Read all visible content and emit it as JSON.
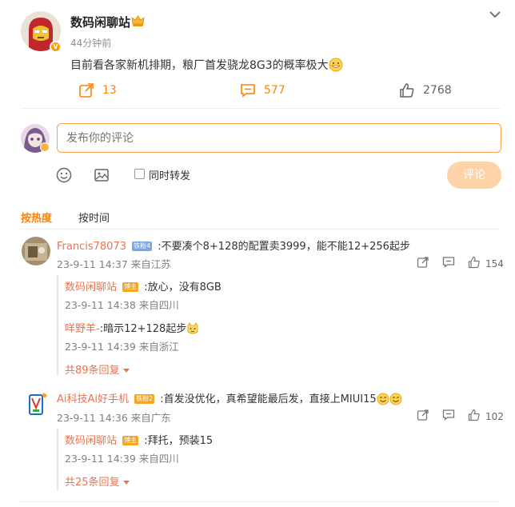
{
  "post": {
    "author": "数码闲聊站",
    "time": "44分钟前",
    "content": "目前看各家新机排期，粮厂首发骁龙8G3的概率极大",
    "verified_badge": "V",
    "actions": {
      "repost_count": "13",
      "comment_count": "577",
      "like_count": "2768"
    }
  },
  "comment_box": {
    "placeholder": "发布你的评论",
    "repost_label": "同时转发",
    "submit_label": "评论"
  },
  "sort_tabs": {
    "hot": "按热度",
    "time": "按时间"
  },
  "comments": [
    {
      "user": "Francis78073",
      "level": "铁粉4",
      "text": ":不要凑个8+128的配置卖3999，能不能12+256起步",
      "meta": "23-9-11 14:37 来自江苏",
      "likes": "154",
      "replies": [
        {
          "user": "数码闲聊站",
          "badge": "博主",
          "text": ":放心，没有8GB",
          "meta": "23-9-11 14:38 来自四川"
        },
        {
          "user": "咩野羊-",
          "badge": "",
          "text": ":暗示12+128起步",
          "meta": "23-9-11 14:39 来自浙江"
        }
      ],
      "more": "共89条回复"
    },
    {
      "user": "Ai科技Ai好手机",
      "level": "铁粉2",
      "text": ":首发没优化，真希望能最后发，直接上MIUI15",
      "meta": "23-9-11 14:36 来自广东",
      "likes": "102",
      "replies": [
        {
          "user": "数码闲聊站",
          "badge": "博主",
          "text": ":拜托，预装15",
          "meta": "23-9-11 14:39 来自四川"
        }
      ],
      "more": "共25条回复"
    }
  ],
  "colors": {
    "accent": "#ff8200",
    "username": "#eb7350",
    "submit_disabled": "#fdd3a7"
  },
  "icons": [
    "chevron-down-icon",
    "crown-icon",
    "repost-icon",
    "comment-icon",
    "like-icon",
    "emoji-icon",
    "image-icon",
    "caret-down-icon"
  ]
}
